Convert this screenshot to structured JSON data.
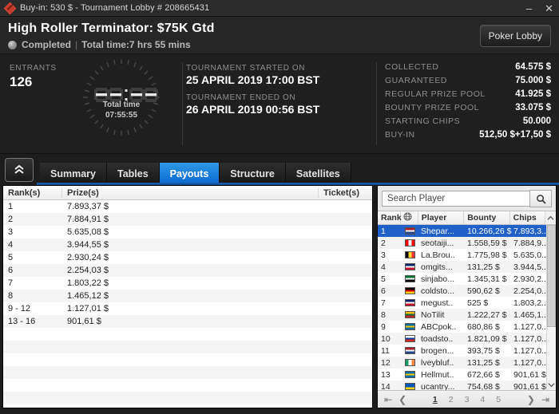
{
  "titlebar": {
    "icon": "diamond-logo-icon",
    "text": "Buy-in: 530 $ - Tournament Lobby # 208665431",
    "minimize": "–",
    "close": "✕"
  },
  "header": {
    "title": "High Roller Terminator: $75K Gtd",
    "status": "Completed",
    "separator": "|",
    "total_time_label": "Total time:7 hrs  55 mins",
    "lobby_button": "Poker Lobby"
  },
  "info": {
    "entrants_label": "ENTRANTS",
    "entrants_value": "126",
    "clock": {
      "digits": "--:--",
      "caption": "Total time",
      "value": "07:55:55"
    },
    "started_label": "TOURNAMENT STARTED ON",
    "started_value": "25 APRIL 2019  17:00 BST",
    "ended_label": "TOURNAMENT ENDED ON",
    "ended_value": "26 APRIL 2019  00:56 BST",
    "stats": [
      {
        "label": "COLLECTED",
        "value": "64.575 $"
      },
      {
        "label": "GUARANTEED",
        "value": "75.000 $"
      },
      {
        "label": "REGULAR PRIZE POOL",
        "value": "41.925 $"
      },
      {
        "label": "BOUNTY PRIZE POOL",
        "value": "33.075 $"
      },
      {
        "label": "STARTING CHIPS",
        "value": "50.000"
      },
      {
        "label": "BUY-IN",
        "value": "512,50 $+17,50 $"
      }
    ]
  },
  "tabs": {
    "collapse_icon": "chevron-double-up-icon",
    "items": [
      {
        "label": "Summary",
        "active": false
      },
      {
        "label": "Tables",
        "active": false
      },
      {
        "label": "Payouts",
        "active": true
      },
      {
        "label": "Structure",
        "active": false
      },
      {
        "label": "Satellites",
        "active": false
      }
    ],
    "active_color": "#1a7fe0"
  },
  "payouts": {
    "columns": [
      "Rank(s)",
      "Prize(s)",
      "Ticket(s)"
    ],
    "rows": [
      {
        "rank": "1",
        "prize": "7.893,37 $",
        "ticket": ""
      },
      {
        "rank": "2",
        "prize": "7.884,91 $",
        "ticket": ""
      },
      {
        "rank": "3",
        "prize": "5.635,08 $",
        "ticket": ""
      },
      {
        "rank": "4",
        "prize": "3.944,55 $",
        "ticket": ""
      },
      {
        "rank": "5",
        "prize": "2.930,24 $",
        "ticket": ""
      },
      {
        "rank": "6",
        "prize": "2.254,03 $",
        "ticket": ""
      },
      {
        "rank": "7",
        "prize": "1.803,22 $",
        "ticket": ""
      },
      {
        "rank": "8",
        "prize": "1.465,12 $",
        "ticket": ""
      },
      {
        "rank": "9 - 12",
        "prize": "1.127,01 $",
        "ticket": ""
      },
      {
        "rank": "13 - 16",
        "prize": "901,61 $",
        "ticket": ""
      }
    ]
  },
  "players": {
    "search_value": "Search Player",
    "search_placeholder": "Search Player",
    "search_icon": "search-icon",
    "columns": {
      "rank": "Rank",
      "country": "globe-icon",
      "player": "Player",
      "bounty": "Bounty",
      "chips": "Chips"
    },
    "sort_icon": "chevron-up-icon",
    "rows": [
      {
        "rank": "1",
        "country": "Netherlands",
        "flag": [
          "#AE1C28",
          "#FFFFFF",
          "#21468B"
        ],
        "player": "Shepar...",
        "bounty": "10.266,26 $",
        "chips": "7.893,3...",
        "selected": true
      },
      {
        "rank": "2",
        "country": "Canada",
        "flag": [
          "#FF0000",
          "#FFFFFF",
          "#FF0000"
        ],
        "flag_dir": "v",
        "player": "seotaiji...",
        "bounty": "1.558,59 $",
        "chips": "7.884,9...",
        "selected": false
      },
      {
        "rank": "3",
        "country": "Belgium",
        "flag": [
          "#000000",
          "#FDDA24",
          "#EF3340"
        ],
        "flag_dir": "v",
        "player": "La.Brou..",
        "bounty": "1.775,98 $",
        "chips": "5.635,0...",
        "selected": false
      },
      {
        "rank": "4",
        "country": "United Kingdom",
        "flag": [
          "#012169",
          "#FFFFFF",
          "#C8102E"
        ],
        "player": "omgits...",
        "bounty": "131,25 $",
        "chips": "3.944,5...",
        "selected": false
      },
      {
        "rank": "5",
        "country": "United Arab Emirates",
        "flag": [
          "#00732F",
          "#FFFFFF",
          "#000000"
        ],
        "player": "sinjabo...",
        "bounty": "1.345,31 $",
        "chips": "2.930,2...",
        "selected": false
      },
      {
        "rank": "6",
        "country": "Germany",
        "flag": [
          "#000000",
          "#DD0000",
          "#FFCE00"
        ],
        "player": "coldsto...",
        "bounty": "590,62 $",
        "chips": "2.254,0...",
        "selected": false
      },
      {
        "rank": "7",
        "country": "United Kingdom",
        "flag": [
          "#012169",
          "#FFFFFF",
          "#C8102E"
        ],
        "player": "megust..",
        "bounty": "525 $",
        "chips": "1.803,2...",
        "selected": false
      },
      {
        "rank": "8",
        "country": "Lithuania",
        "flag": [
          "#FDB913",
          "#006A44",
          "#C1272D"
        ],
        "player": "NoTilit",
        "bounty": "1.222,27 $",
        "chips": "1.465,1...",
        "selected": false
      },
      {
        "rank": "9",
        "country": "Sweden",
        "flag": [
          "#006AA7",
          "#FECC00",
          "#006AA7"
        ],
        "player": "ABCpok..",
        "bounty": "680,86 $",
        "chips": "1.127,0...",
        "selected": false
      },
      {
        "rank": "10",
        "country": "Russia",
        "flag": [
          "#FFFFFF",
          "#0039A6",
          "#D52B1E"
        ],
        "player": "toadsto..",
        "bounty": "1.821,09 $",
        "chips": "1.127,0...",
        "selected": false
      },
      {
        "rank": "11",
        "country": "Netherlands",
        "flag": [
          "#AE1C28",
          "#FFFFFF",
          "#21468B"
        ],
        "player": "brogen...",
        "bounty": "393,75 $",
        "chips": "1.127,0...",
        "selected": false
      },
      {
        "rank": "12",
        "country": "Ireland",
        "flag": [
          "#169B62",
          "#FFFFFF",
          "#FF883E"
        ],
        "flag_dir": "v",
        "player": "lveybluf..",
        "bounty": "131,25 $",
        "chips": "1.127,0...",
        "selected": false
      },
      {
        "rank": "13",
        "country": "Sweden",
        "flag": [
          "#006AA7",
          "#FECC00",
          "#006AA7"
        ],
        "player": "Hellmut..",
        "bounty": "672,66 $",
        "chips": "901,61 $",
        "selected": false
      },
      {
        "rank": "14",
        "country": "Ukraine",
        "flag": [
          "#0057B7",
          "#0057B7",
          "#FFD700"
        ],
        "player": "ucantry...",
        "bounty": "754,68 $",
        "chips": "901,61 $",
        "selected": false
      }
    ],
    "pager": {
      "first": "first-page-icon",
      "prev": "previous-page-icon",
      "pages": [
        "1",
        "2",
        "3",
        "4",
        "5"
      ],
      "active_page": "1",
      "next": "next-page-icon",
      "last": "last-page-icon"
    }
  }
}
